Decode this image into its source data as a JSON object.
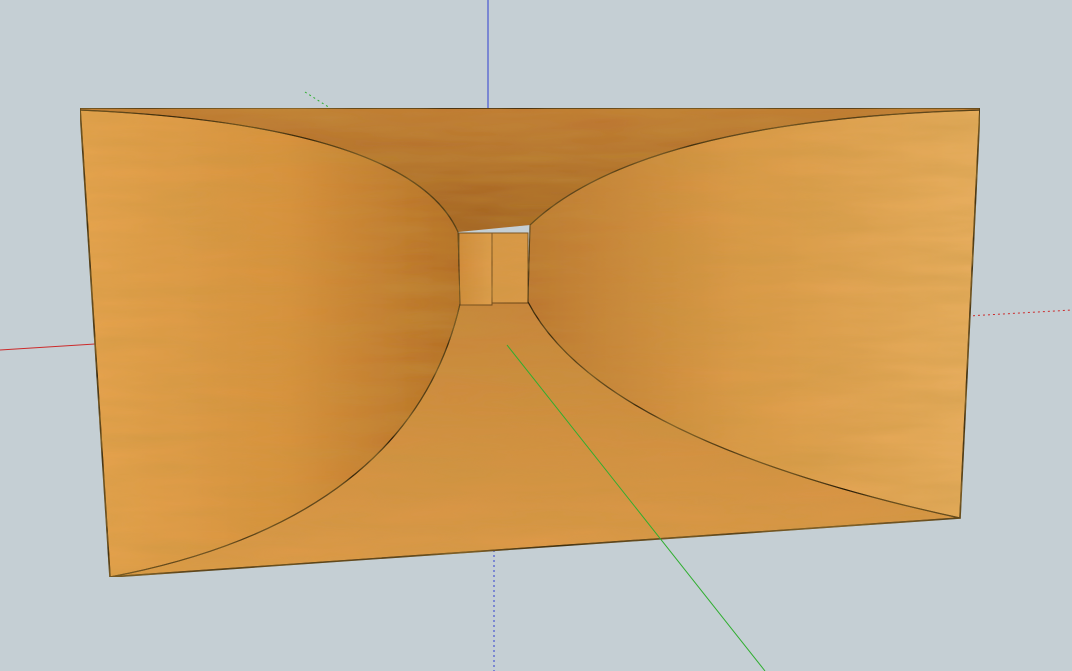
{
  "scene": {
    "background_color": "#c5cfd4",
    "axis_colors": {
      "red": "#cc2b2b",
      "green": "#2fae2f",
      "blue": "#2e3fcf"
    },
    "material": {
      "name": "wood-maple",
      "base": "#d9943f",
      "light": "#f0b769",
      "dark": "#b3681f",
      "edge": "#000000"
    },
    "model": "horn-enclosure"
  }
}
